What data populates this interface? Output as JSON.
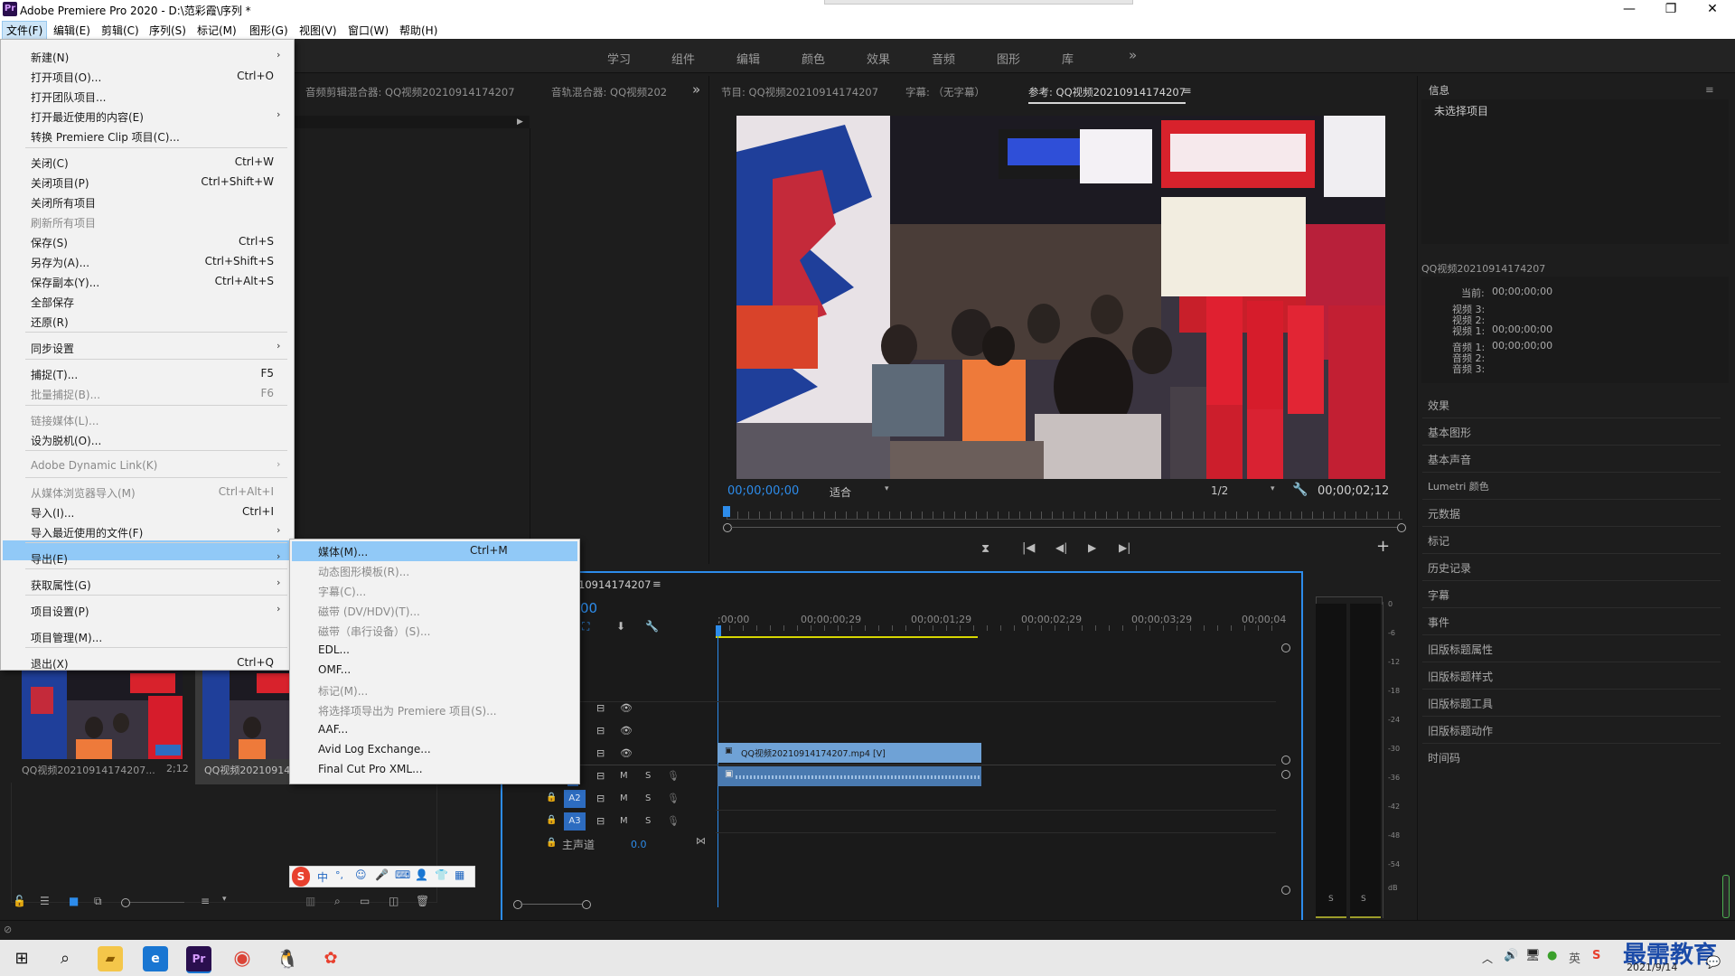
{
  "window": {
    "title": "Adobe Premiere Pro 2020 - D:\\范彩霞\\序列 *",
    "minimize": "—",
    "maximize": "❐",
    "close": "✕"
  },
  "menubar": [
    "文件(F)",
    "编辑(E)",
    "剪辑(C)",
    "序列(S)",
    "标记(M)",
    "图形(G)",
    "视图(V)",
    "窗口(W)",
    "帮助(H)"
  ],
  "workspaces": [
    "学习",
    "组件",
    "编辑",
    "颜色",
    "效果",
    "音频",
    "图形",
    "库"
  ],
  "workspaces_more": "»",
  "left_tabs": {
    "audio_clip_mixer": "音频剪辑混合器: QQ视频20210914174207",
    "audio_track_mixer": "音轨混合器: QQ视频202",
    "more": "»"
  },
  "monitor_tabs": {
    "program": "节目: QQ视频20210914174207",
    "captions": "字幕: （无字幕）",
    "reference": "参考: QQ视频20210914174207",
    "menu": "≡"
  },
  "monitor": {
    "timecode": "00;00;00;00",
    "fit": "适合",
    "resolution": "1/2",
    "duration": "00;00;02;12"
  },
  "file_menu": {
    "items": [
      {
        "label": "新建(N)",
        "shortcut": "",
        "arrow": "›",
        "disabled": false
      },
      {
        "label": "打开项目(O)...",
        "shortcut": "Ctrl+O",
        "arrow": "",
        "disabled": false
      },
      {
        "label": "打开团队项目...",
        "shortcut": "",
        "arrow": "",
        "disabled": false
      },
      {
        "label": "打开最近使用的内容(E)",
        "shortcut": "",
        "arrow": "›",
        "disabled": false
      },
      {
        "label": "转换 Premiere Clip 项目(C)...",
        "shortcut": "",
        "arrow": "",
        "disabled": false
      },
      {
        "label": "关闭(C)",
        "shortcut": "Ctrl+W",
        "arrow": "",
        "disabled": false
      },
      {
        "label": "关闭项目(P)",
        "shortcut": "Ctrl+Shift+W",
        "arrow": "",
        "disabled": false
      },
      {
        "label": "关闭所有项目",
        "shortcut": "",
        "arrow": "",
        "disabled": false
      },
      {
        "label": "刷新所有项目",
        "shortcut": "",
        "arrow": "",
        "disabled": true
      },
      {
        "label": "保存(S)",
        "shortcut": "Ctrl+S",
        "arrow": "",
        "disabled": false
      },
      {
        "label": "另存为(A)...",
        "shortcut": "Ctrl+Shift+S",
        "arrow": "",
        "disabled": false
      },
      {
        "label": "保存副本(Y)...",
        "shortcut": "Ctrl+Alt+S",
        "arrow": "",
        "disabled": false
      },
      {
        "label": "全部保存",
        "shortcut": "",
        "arrow": "",
        "disabled": false
      },
      {
        "label": "还原(R)",
        "shortcut": "",
        "arrow": "",
        "disabled": false
      },
      {
        "label": "同步设置",
        "shortcut": "",
        "arrow": "›",
        "disabled": false
      },
      {
        "label": "捕捉(T)...",
        "shortcut": "F5",
        "arrow": "",
        "disabled": false
      },
      {
        "label": "批量捕捉(B)...",
        "shortcut": "F6",
        "arrow": "",
        "disabled": true
      },
      {
        "label": "链接媒体(L)...",
        "shortcut": "",
        "arrow": "",
        "disabled": true
      },
      {
        "label": "设为脱机(O)...",
        "shortcut": "",
        "arrow": "",
        "disabled": false
      },
      {
        "label": "Adobe Dynamic Link(K)",
        "shortcut": "",
        "arrow": "›",
        "disabled": true
      },
      {
        "label": "从媒体浏览器导入(M)",
        "shortcut": "Ctrl+Alt+I",
        "arrow": "",
        "disabled": true
      },
      {
        "label": "导入(I)...",
        "shortcut": "Ctrl+I",
        "arrow": "",
        "disabled": false
      },
      {
        "label": "导入最近使用的文件(F)",
        "shortcut": "",
        "arrow": "›",
        "disabled": false
      },
      {
        "label": "导出(E)",
        "shortcut": "",
        "arrow": "›",
        "disabled": false
      },
      {
        "label": "获取属性(G)",
        "shortcut": "",
        "arrow": "›",
        "disabled": false
      },
      {
        "label": "项目设置(P)",
        "shortcut": "",
        "arrow": "›",
        "disabled": false
      },
      {
        "label": "项目管理(M)...",
        "shortcut": "",
        "arrow": "",
        "disabled": false
      },
      {
        "label": "退出(X)",
        "shortcut": "Ctrl+Q",
        "arrow": "",
        "disabled": false
      }
    ]
  },
  "export_submenu": {
    "items": [
      {
        "label": "媒体(M)...",
        "shortcut": "Ctrl+M",
        "disabled": false
      },
      {
        "label": "动态图形模板(R)...",
        "shortcut": "",
        "disabled": true
      },
      {
        "label": "字幕(C)...",
        "shortcut": "",
        "disabled": true
      },
      {
        "label": "磁带 (DV/HDV)(T)...",
        "shortcut": "",
        "disabled": true
      },
      {
        "label": "磁带（串行设备）(S)...",
        "shortcut": "",
        "disabled": true
      },
      {
        "label": "EDL...",
        "shortcut": "",
        "disabled": false
      },
      {
        "label": "OMF...",
        "shortcut": "",
        "disabled": false
      },
      {
        "label": "标记(M)...",
        "shortcut": "",
        "disabled": true
      },
      {
        "label": "将选择项导出为 Premiere 项目(S)...",
        "shortcut": "",
        "disabled": true
      },
      {
        "label": "AAF...",
        "shortcut": "",
        "disabled": false
      },
      {
        "label": "Avid Log Exchange...",
        "shortcut": "",
        "disabled": false
      },
      {
        "label": "Final Cut Pro XML...",
        "shortcut": "",
        "disabled": false
      }
    ]
  },
  "info_panel": {
    "tab": "信息",
    "menu": "≡",
    "no_selection": "未选择项目",
    "sequence": "QQ视频20210914174207",
    "rows": [
      {
        "label": "当前:",
        "value": "00;00;00;00"
      },
      {
        "label": "视频 3:",
        "value": ""
      },
      {
        "label": "视频 2:",
        "value": ""
      },
      {
        "label": "视频 1:",
        "value": "00;00;00;00"
      },
      {
        "label": "音频 1:",
        "value": "00;00;00;00"
      },
      {
        "label": "音频 2:",
        "value": ""
      },
      {
        "label": "音频 3:",
        "value": ""
      }
    ]
  },
  "right_panels": [
    "效果",
    "基本图形",
    "基本声音",
    "Lumetri 颜色",
    "元数据",
    "标记",
    "历史记录",
    "字幕",
    "事件",
    "旧版标题属性",
    "旧版标题样式",
    "旧版标题工具",
    "旧版标题动作",
    "时间码"
  ],
  "timeline": {
    "tab": "10914174207",
    "menu": "≡",
    "timecode": "00",
    "ruler": [
      ";00;00",
      "00;00;00;29",
      "00;00;01;29",
      "00;00;02;29",
      "00;00;03;29",
      "00;00;04"
    ],
    "video_clip": "QQ视频20210914174207.mp4 [V]",
    "tracks": [
      {
        "name": "A2",
        "m": "M",
        "s": "S"
      },
      {
        "name": "A3",
        "m": "M",
        "s": "S"
      }
    ],
    "track_m": "M",
    "track_s": "S",
    "master": {
      "label": "主声道",
      "value": "0.0"
    }
  },
  "project_panel": {
    "items": [
      {
        "name": "QQ视频20210914174207...",
        "duration": "2;12"
      },
      {
        "name": "QQ视频20210914",
        "duration": ""
      }
    ]
  },
  "audio_meter": {
    "ticks": [
      "0",
      "-6",
      "-12",
      "-18",
      "-24",
      "-30",
      "-36",
      "-42",
      "-48",
      "-54",
      "dB"
    ],
    "solo_left": "S",
    "solo_right": "S"
  },
  "ime_toolbar": {
    "logo": "S",
    "lang": "中"
  },
  "taskbar": {
    "date": "2021/9/14",
    "watermark": "最需教育"
  },
  "colors": {
    "accent_blue": "#2d8ceb",
    "menu_highlight": "#91c9f7",
    "clip_video": "#6fa2d6",
    "clip_audio": "#4a7ab0",
    "playhead": "#2d8ceb"
  }
}
